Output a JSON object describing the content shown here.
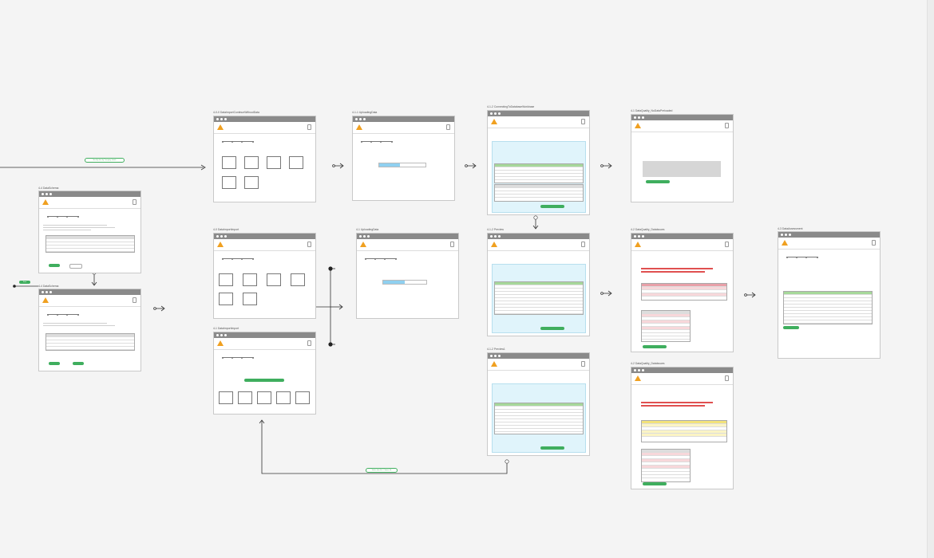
{
  "canvas": {
    "background": "#f4f4f4"
  },
  "frames": {
    "a": {
      "title": "4-4 DataSchema"
    },
    "b": {
      "title": "4-4 DataSchema"
    },
    "c": {
      "title": "4-0-0 DataImportContinueWithoutData"
    },
    "d": {
      "title": "4-1-1 UploadingData"
    },
    "e": {
      "title": "4-1-2 ConnectingToDatabaseWorkbase"
    },
    "f": {
      "title": "4-1 DataQuality_NoDataPreloaded"
    },
    "g": {
      "title": "4-0 DataImportImport"
    },
    "h": {
      "title": "4-1 UploadingData"
    },
    "i": {
      "title": "4-1-2 Preview"
    },
    "j": {
      "title": "4-2 DataQuality_DataIssues"
    },
    "k": {
      "title": "4-3 DataAssessment"
    },
    "l": {
      "title": "4-1 DataImportImport"
    },
    "m": {
      "title": "4-1-2 Preview1"
    },
    "n": {
      "title": "4-2 DataQuality_DataIssues"
    }
  },
  "labels": {
    "flow_link_top": "Identify data by Company details",
    "flow_link_bottom": "Select data file / Choose file",
    "start_badge": "Start"
  },
  "colors": {
    "accent_green": "#3fae5e",
    "header_gray": "#8a8a8a",
    "logo_orange": "#f0a020",
    "preview_cyan": "#e0f4fb",
    "table_green": "#a6d89a",
    "issue_red": "#e8a0a8",
    "highlight_yellow": "#f2e27a"
  }
}
